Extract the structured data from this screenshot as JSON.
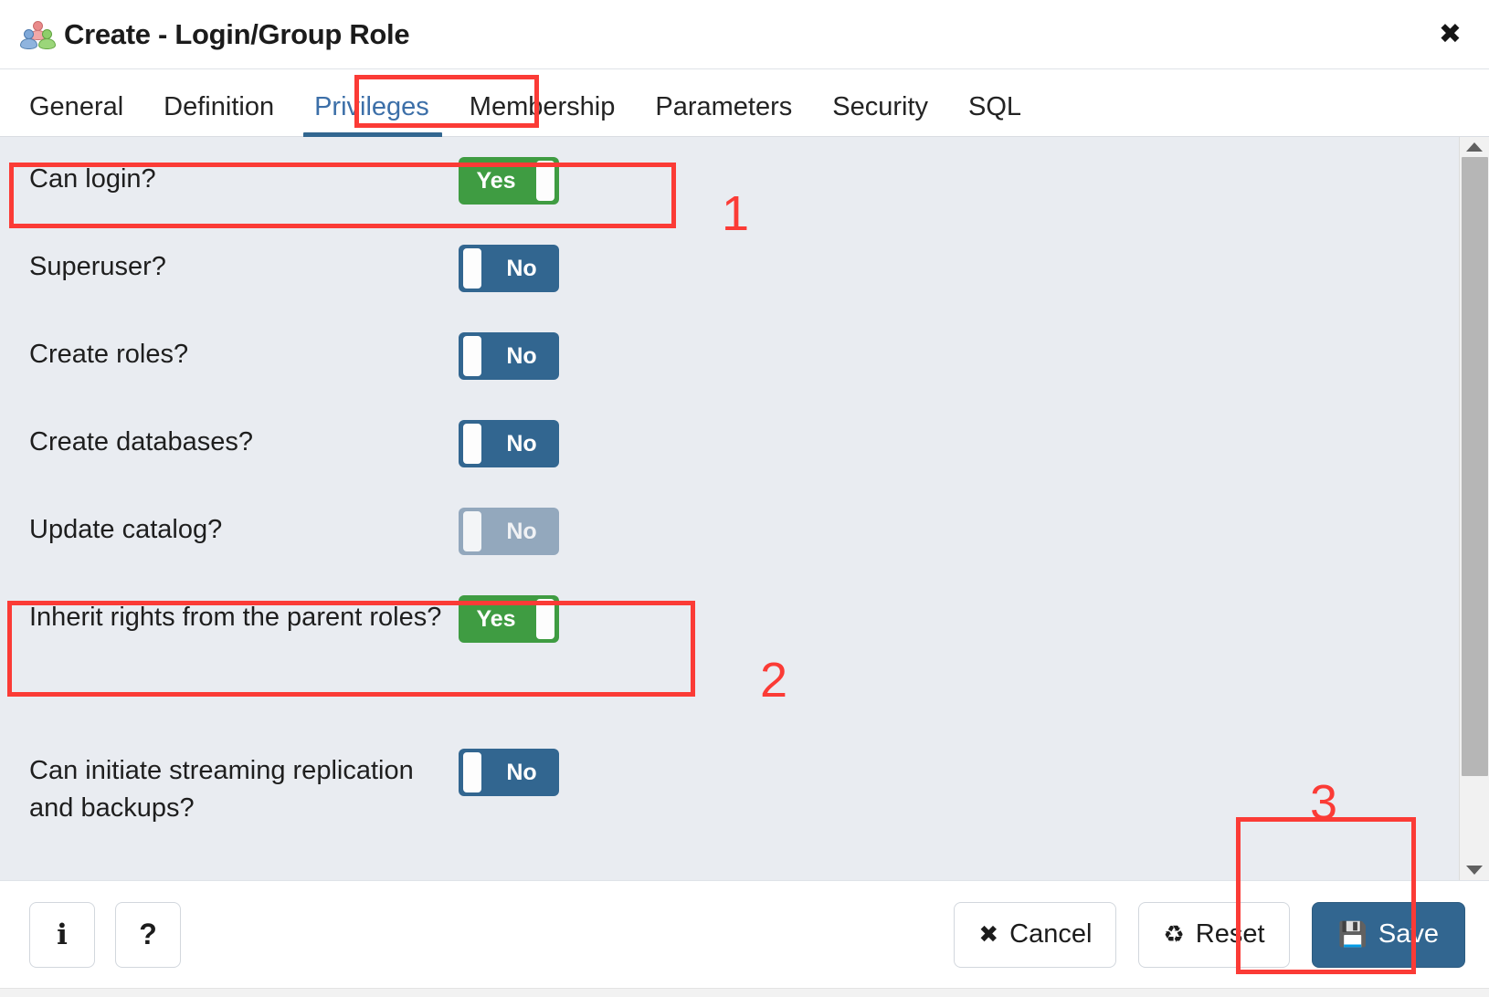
{
  "window": {
    "title": "Create - Login/Group Role",
    "icon": "group-role-icon",
    "close_label": "✖"
  },
  "tabs": [
    {
      "label": "General",
      "active": false
    },
    {
      "label": "Definition",
      "active": false
    },
    {
      "label": "Privileges",
      "active": true
    },
    {
      "label": "Membership",
      "active": false
    },
    {
      "label": "Parameters",
      "active": false
    },
    {
      "label": "Security",
      "active": false
    },
    {
      "label": "SQL",
      "active": false
    }
  ],
  "fields": [
    {
      "label": "Can login?",
      "value": "Yes",
      "state": "on",
      "disabled": false,
      "tall": false
    },
    {
      "label": "Superuser?",
      "value": "No",
      "state": "off",
      "disabled": false,
      "tall": false
    },
    {
      "label": "Create roles?",
      "value": "No",
      "state": "off",
      "disabled": false,
      "tall": false
    },
    {
      "label": "Create databases?",
      "value": "No",
      "state": "off",
      "disabled": false,
      "tall": false
    },
    {
      "label": "Update catalog?",
      "value": "No",
      "state": "off",
      "disabled": true,
      "tall": false
    },
    {
      "label": "Inherit rights from the parent roles?",
      "value": "Yes",
      "state": "on",
      "disabled": false,
      "tall": true
    },
    {
      "label": "Can initiate streaming replication and backups?",
      "value": "No",
      "state": "off",
      "disabled": false,
      "tall": true
    }
  ],
  "scrollbar": {
    "up_arrow": "scroll-up-arrow",
    "down_arrow": "scroll-down-arrow",
    "thumb_position_percent": 0
  },
  "footer": {
    "info_label": "i",
    "help_label": "?",
    "cancel_label": "Cancel",
    "cancel_icon": "✖",
    "reset_label": "Reset",
    "reset_icon": "♻",
    "save_label": "Save",
    "save_icon": "💾"
  },
  "annotations": [
    {
      "number": "1",
      "target": "can-login-row"
    },
    {
      "number": "2",
      "target": "inherit-rights-row"
    },
    {
      "number": "3",
      "target": "save-button"
    }
  ],
  "colors": {
    "accent_blue": "#326690",
    "toggle_on_green": "#3f9c42",
    "toggle_off_blue": "#326690",
    "toggle_disabled": "#93a8bd",
    "body_background": "#e9ecf1",
    "annotation_red": "#fb3b36",
    "active_tab_text": "#3c6fa8"
  }
}
